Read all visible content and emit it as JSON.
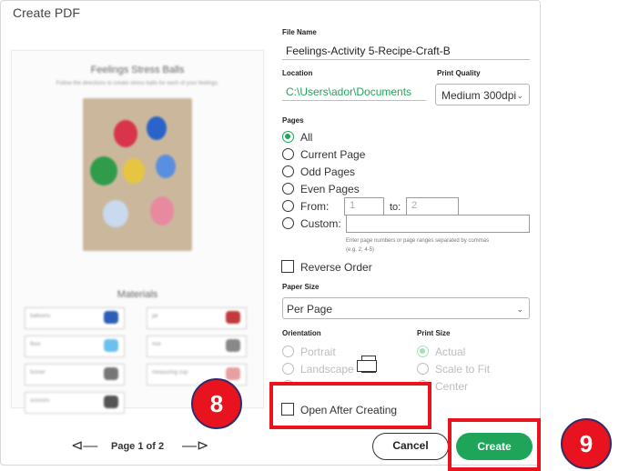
{
  "dialog": {
    "title": "Create PDF",
    "file_name": {
      "label": "File Name",
      "value": "Feelings-Activity 5-Recipe-Craft-B"
    },
    "location": {
      "label": "Location",
      "value": "C:\\Users\\ador\\Documents"
    },
    "print_quality": {
      "label": "Print Quality",
      "selected": "Medium 300dpi"
    },
    "pages": {
      "label": "Pages",
      "options": [
        "All",
        "Current Page",
        "Odd Pages",
        "Even Pages",
        "From:",
        "Custom:"
      ],
      "selected": "All",
      "from_value": "1",
      "to_label": "to:",
      "to_value": "2",
      "custom_hint": "Enter page numbers or page ranges separated by commas",
      "custom_example": "(e.g. 2, 4-5)",
      "reverse_order_label": "Reverse Order"
    },
    "paper_size": {
      "label": "Paper Size",
      "selected": "Per Page"
    },
    "orientation": {
      "label": "Orientation",
      "options": [
        "Portrait",
        "Landscape"
      ]
    },
    "print_size": {
      "label": "Print Size",
      "options": [
        "Actual",
        "Scale to Fit",
        "Center"
      ],
      "selected": "Actual"
    },
    "open_after_label": "Open After Creating",
    "cancel_label": "Cancel",
    "create_label": "Create"
  },
  "preview": {
    "title": "Feelings Stress Balls",
    "subtitle": "Follow the directions to create stress balls for each of your feelings.",
    "materials_heading": "Materials",
    "materials": [
      "balloons",
      "flour",
      "rice",
      "jar",
      "funnel",
      "measuring cup",
      "scissors"
    ],
    "pager": "Page 1 of 2"
  },
  "annotations": {
    "badge_8": "8",
    "badge_9": "9",
    "accent": "#e8131e",
    "button_green": "#1fa55a"
  }
}
